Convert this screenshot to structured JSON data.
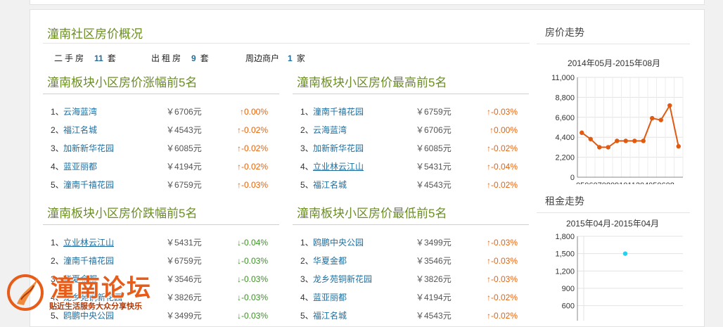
{
  "overview": {
    "title": "潼南社区房价概况",
    "stats": [
      {
        "label": "二手房",
        "count": "11",
        "unit": "套"
      },
      {
        "label": "出租房",
        "count": "9",
        "unit": "套"
      },
      {
        "label": "周边商户",
        "count": "1",
        "unit": "家"
      }
    ]
  },
  "rise_top": {
    "title": "潼南板块小区房价涨幅前5名",
    "rows": [
      {
        "idx": "1、",
        "name": "云海蓝湾",
        "price": "￥6706元",
        "change": "↑0.00%",
        "dir": "up"
      },
      {
        "idx": "2、",
        "name": "福江名城",
        "price": "￥4543元",
        "change": "↑-0.02%",
        "dir": "up"
      },
      {
        "idx": "3、",
        "name": "加新新华花园",
        "price": "￥6085元",
        "change": "↑-0.02%",
        "dir": "up"
      },
      {
        "idx": "4、",
        "name": "蓝亚丽都",
        "price": "￥4194元",
        "change": "↑-0.02%",
        "dir": "up"
      },
      {
        "idx": "5、",
        "name": "潼南千禧花园",
        "price": "￥6759元",
        "change": "↑-0.03%",
        "dir": "up"
      }
    ]
  },
  "highest": {
    "title": "潼南板块小区房价最高前5名",
    "rows": [
      {
        "idx": "1、",
        "name": "潼南千禧花园",
        "price": "￥6759元",
        "change": "↑-0.03%",
        "dir": "up"
      },
      {
        "idx": "2、",
        "name": "云海蓝湾",
        "price": "￥6706元",
        "change": "↑0.00%",
        "dir": "up"
      },
      {
        "idx": "3、",
        "name": "加新新华花园",
        "price": "￥6085元",
        "change": "↑-0.02%",
        "dir": "up"
      },
      {
        "idx": "4、",
        "name": "立业林云江山",
        "price": "￥5431元",
        "change": "↑-0.04%",
        "dir": "up",
        "ul": true
      },
      {
        "idx": "5、",
        "name": "福江名城",
        "price": "￥4543元",
        "change": "↑-0.02%",
        "dir": "up"
      }
    ]
  },
  "fall_top": {
    "title": "潼南板块小区房价跌幅前5名",
    "rows": [
      {
        "idx": "1、",
        "name": "立业林云江山",
        "price": "￥5431元",
        "change": "↓-0.04%",
        "dir": "down",
        "ul": true
      },
      {
        "idx": "2、",
        "name": "潼南千禧花园",
        "price": "￥6759元",
        "change": "↓-0.03%",
        "dir": "down"
      },
      {
        "idx": "3、",
        "name": "华夏金都",
        "price": "￥3546元",
        "change": "↓-0.03%",
        "dir": "down"
      },
      {
        "idx": "4、",
        "name": "龙乡苑铜新花园",
        "price": "￥3826元",
        "change": "↓-0.03%",
        "dir": "down"
      },
      {
        "idx": "5、",
        "name": "鸥鹏中央公园",
        "price": "￥3499元",
        "change": "↓-0.03%",
        "dir": "down"
      }
    ]
  },
  "lowest": {
    "title": "潼南板块小区房价最低前5名",
    "rows": [
      {
        "idx": "1、",
        "name": "鸥鹏中央公园",
        "price": "￥3499元",
        "change": "↑-0.03%",
        "dir": "up"
      },
      {
        "idx": "2、",
        "name": "华夏金都",
        "price": "￥3546元",
        "change": "↑-0.03%",
        "dir": "up"
      },
      {
        "idx": "3、",
        "name": "龙乡苑铜新花园",
        "price": "￥3826元",
        "change": "↑-0.03%",
        "dir": "up"
      },
      {
        "idx": "4、",
        "name": "蓝亚丽都",
        "price": "￥4194元",
        "change": "↑-0.02%",
        "dir": "up"
      },
      {
        "idx": "5、",
        "name": "福江名城",
        "price": "￥4543元",
        "change": "↑-0.02%",
        "dir": "up"
      }
    ]
  },
  "side": {
    "price_title": "房价走势",
    "rent_title": "租金走势"
  },
  "colors": {
    "accent": "#6b8e23",
    "link": "#1e6fa0",
    "up": "#e8630a",
    "down": "#3f8f2a",
    "line": "#e05a12",
    "rent": "#22d3ee"
  },
  "watermark": {
    "title": "潼南论坛",
    "subtitle": "贴近生活服务大众分享快乐"
  },
  "chart_data": [
    {
      "type": "line",
      "title": "2014年05月-2015年08月",
      "x": [
        "05",
        "06",
        "07",
        "08",
        "09",
        "10",
        "11",
        "12",
        "04",
        "05",
        "06",
        "08"
      ],
      "tick_labels": "05060708091011204050608",
      "values": [
        4900,
        4200,
        3300,
        3300,
        4000,
        4000,
        4000,
        4000,
        6500,
        6300,
        7900,
        3400
      ],
      "ylim": [
        0,
        11000
      ],
      "yticks": [
        "0",
        "2,200",
        "4,400",
        "6,600",
        "8,800",
        "11,000"
      ],
      "grid": true
    },
    {
      "type": "scatter",
      "title": "2015年04月-2015年04月",
      "x": [
        ""
      ],
      "values": [
        1500
      ],
      "ylim": [
        0,
        1800
      ],
      "yticks": [
        "600",
        "900",
        "1,200",
        "1,500",
        "1,800"
      ],
      "grid": true
    }
  ]
}
